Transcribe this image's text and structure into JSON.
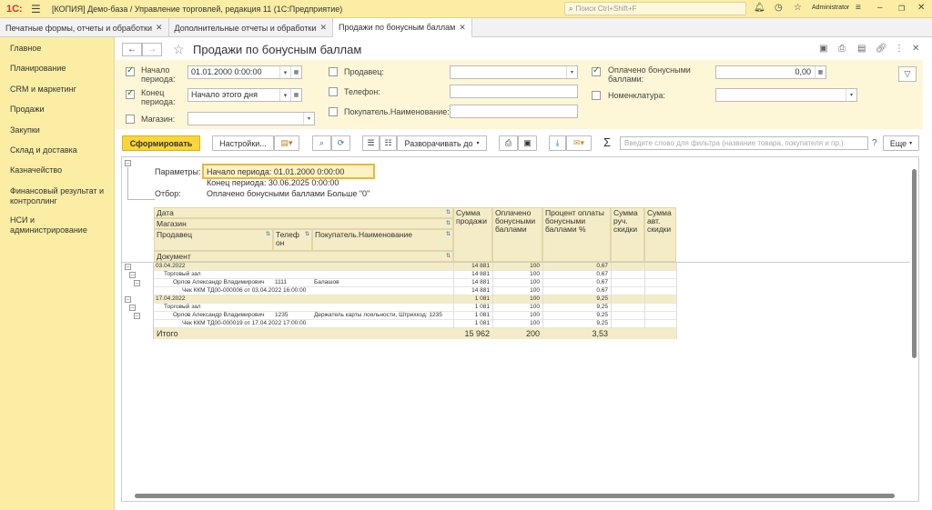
{
  "titlebar": {
    "logo": "1С:",
    "title": "[КОПИЯ] Демо-база / Управление торговлей, редакция 11  (1С:Предприятие)",
    "search_placeholder": "Поиск Ctrl+Shift+F",
    "user": "Administrator"
  },
  "tabs": [
    {
      "label": "Печатные формы, отчеты и обработки"
    },
    {
      "label": "Дополнительные отчеты и обработки"
    },
    {
      "label": "Продажи по бонусным баллам"
    }
  ],
  "sidebar": {
    "items": [
      {
        "label": "Главное"
      },
      {
        "label": "Планирование"
      },
      {
        "label": "CRM и маркетинг"
      },
      {
        "label": "Продажи"
      },
      {
        "label": "Закупки"
      },
      {
        "label": "Склад и доставка"
      },
      {
        "label": "Казначейство"
      },
      {
        "label": "Финансовый результат и контроллинг"
      },
      {
        "label": "НСИ и администрирование"
      }
    ]
  },
  "page": {
    "title": "Продажи по бонусным баллам"
  },
  "filters": {
    "start_label": "Начало периода:",
    "start_value": "01.01.2000  0:00:00",
    "end_label": "Конец периода:",
    "end_value": "Начало этого дня",
    "store_label": "Магазин:",
    "seller_label": "Продавец:",
    "phone_label": "Телефон:",
    "buyer_label": "Покупатель.Наименование:",
    "bonus_label": "Оплачено бонусными баллами:",
    "bonus_value": "0,00",
    "nom_label": "Номенклатура:"
  },
  "toolbar": {
    "generate": "Сформировать",
    "settings": "Настройки...",
    "expand": "Разворачивать до",
    "filter_placeholder": "Введите слово для фильтра (название товара, покупателя и пр.)",
    "help": "?",
    "more": "Еще"
  },
  "report": {
    "params_label": "Параметры:",
    "param1": "Начало периода: 01.01.2000 0:00:00",
    "param2": "Конец периода: 30.06.2025 0:00:00",
    "filter_label": "Отбор:",
    "filter_value": "Оплачено бонусными баллами Больше \"0\"",
    "headers": {
      "date": "Дата",
      "store": "Магазин",
      "seller": "Продавец",
      "phone": "Телеф он",
      "buyer": "Покупатель.Наименование",
      "doc": "Документ",
      "sum": "Сумма продажи",
      "paid_bonus": "Оплачено бонусными баллами",
      "pct": "Процент оплаты бонусными баллами %",
      "manual": "Сумма руч. скидки",
      "auto": "Сумма авт. скидки"
    },
    "rows": [
      {
        "level": 0,
        "label": "03.04.2022",
        "phone": "",
        "buyer": "",
        "sum": "14 881",
        "bonus": "100",
        "pct": "0,67"
      },
      {
        "level": 1,
        "label": "Торговый зал",
        "phone": "",
        "buyer": "",
        "sum": "14 881",
        "bonus": "100",
        "pct": "0,67"
      },
      {
        "level": 2,
        "label": "Орлов Александр Владимирович",
        "phone": "1111",
        "buyer": "Балашов",
        "sum": "14 881",
        "bonus": "100",
        "pct": "0,67"
      },
      {
        "level": 3,
        "label": "Чек ККМ ТД00-000006 от 03.04.2022 16:00:00",
        "phone": "",
        "buyer": "",
        "sum": "14 881",
        "bonus": "100",
        "pct": "0,67"
      },
      {
        "level": 0,
        "label": "17.04.2022",
        "phone": "",
        "buyer": "",
        "sum": "1 081",
        "bonus": "100",
        "pct": "9,25"
      },
      {
        "level": 1,
        "label": "Торговый зал",
        "phone": "",
        "buyer": "",
        "sum": "1 081",
        "bonus": "100",
        "pct": "9,25"
      },
      {
        "level": 2,
        "label": "Орлов Александр Владимирович",
        "phone": "1235",
        "buyer": "Держатель карты лояльности, Штрихкод: 1235",
        "sum": "1 081",
        "bonus": "100",
        "pct": "9,25"
      },
      {
        "level": 3,
        "label": "Чек ККМ ТД00-000019 от 17.04.2022 17:00:00",
        "phone": "",
        "buyer": "",
        "sum": "1 081",
        "bonus": "100",
        "pct": "9,25"
      }
    ],
    "total": {
      "label": "Итого",
      "sum": "15 962",
      "bonus": "200",
      "pct": "3,53"
    }
  }
}
